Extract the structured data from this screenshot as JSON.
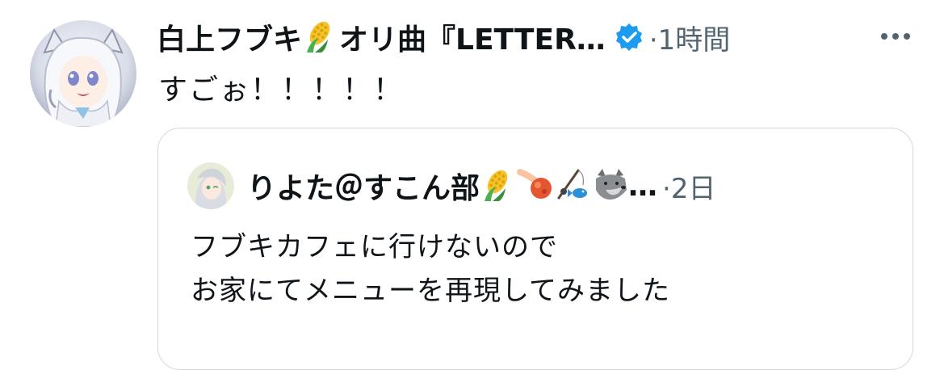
{
  "tweet": {
    "display_name": "白上フブキ",
    "display_name_suffix": "オリ曲『LETTER…",
    "name_emoji": "corn-icon",
    "verified_icon": "verified-badge-icon",
    "timestamp": "·1時間",
    "text": "すごぉ！！！！！",
    "more_icon": "more-options-icon"
  },
  "quote": {
    "display_name": "りよた＠すこん部",
    "name_suffix": "…",
    "name_emojis": [
      "corn-icon",
      "comet-icon",
      "fishing-pole-icon",
      "wolf-icon"
    ],
    "timestamp": "·2日",
    "text_lines": [
      "フブキカフェに行けないので",
      "お家にてメニューを再現してみました"
    ]
  },
  "colors": {
    "text_primary": "#0f1419",
    "text_secondary": "#536471",
    "verified_blue": "#1d9bf0",
    "card_border": "#cfd9de"
  }
}
